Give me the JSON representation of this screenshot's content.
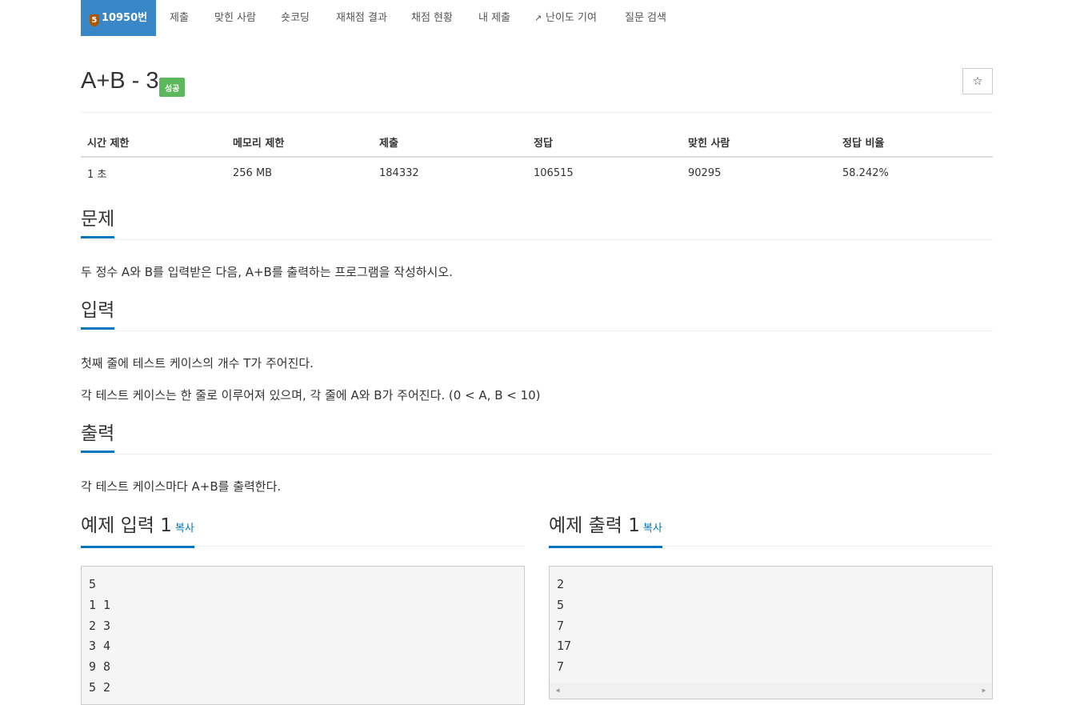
{
  "nav": {
    "problem_badge_tier": "5",
    "problem_number": "10950번",
    "items": [
      "제출",
      "맞힌 사람",
      "숏코딩",
      "재채점 결과",
      "채점 현황",
      "내 제출",
      "난이도 기여",
      "질문 검색"
    ]
  },
  "title": {
    "text": "A+B - 3",
    "status": "성공",
    "star": "☆"
  },
  "info_table": {
    "headers": [
      "시간 제한",
      "메모리 제한",
      "제출",
      "정답",
      "맞힌 사람",
      "정답 비율"
    ],
    "values": [
      "1 초",
      "256 MB",
      "184332",
      "106515",
      "90295",
      "58.242%"
    ]
  },
  "sections": {
    "problem": {
      "title": "문제",
      "text": "두 정수 A와 B를 입력받은 다음, A+B를 출력하는 프로그램을 작성하시오."
    },
    "input": {
      "title": "입력",
      "lines": [
        "첫째 줄에 테스트 케이스의 개수 T가 주어진다.",
        "각 테스트 케이스는 한 줄로 이루어져 있으며, 각 줄에 A와 B가 주어진다. (0 < A, B < 10)"
      ]
    },
    "output": {
      "title": "출력",
      "text": "각 테스트 케이스마다 A+B를 출력한다."
    },
    "sample_input": {
      "title": "예제 입력 1",
      "copy": "복사",
      "content": "5\n1 1\n2 3\n3 4\n9 8\n5 2"
    },
    "sample_output": {
      "title": "예제 출력 1",
      "copy": "복사",
      "content": "2\n5\n7\n17\n7"
    }
  },
  "colors": {
    "nav_active": "#3a87c8",
    "status_success": "#5cb85c",
    "accent": "#0076c0",
    "tier_bronze": "#ad5600"
  }
}
